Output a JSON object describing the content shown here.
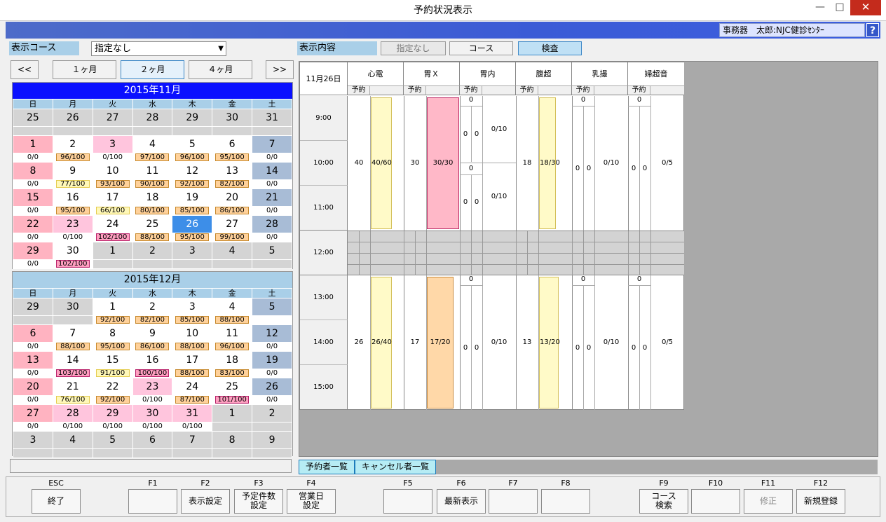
{
  "window": {
    "title": "予約状況表示",
    "minimize": "—",
    "maximize": "□",
    "close": "✕"
  },
  "header": {
    "user": "事務器　太郎:NJC健診ｾﾝﾀｰ",
    "help": "?"
  },
  "course": {
    "label": "表示コース",
    "value": "指定なし"
  },
  "display": {
    "label": "表示内容",
    "opt_none": "指定なし",
    "opt_course": "コース",
    "opt_exam": "検査"
  },
  "nav": {
    "prev": "<<",
    "m1": "１ヶ月",
    "m2": "２ヶ月",
    "m4": "４ヶ月",
    "next": ">>"
  },
  "dow": [
    "日",
    "月",
    "火",
    "水",
    "木",
    "金",
    "土"
  ],
  "calendars": [
    {
      "title": "2015年11月",
      "weeks": [
        {
          "days": [
            "25",
            "26",
            "27",
            "28",
            "29",
            "30",
            "31"
          ],
          "counts": [
            "",
            "",
            "",
            "",
            "",
            "",
            ""
          ]
        },
        {
          "days": [
            "1",
            "2",
            "3",
            "4",
            "5",
            "6",
            "7"
          ],
          "counts": [
            "0/0",
            "96/100",
            "0/100",
            "97/100",
            "96/100",
            "95/100",
            "0/0"
          ]
        },
        {
          "days": [
            "8",
            "9",
            "10",
            "11",
            "12",
            "13",
            "14"
          ],
          "counts": [
            "0/0",
            "77/100",
            "93/100",
            "90/100",
            "92/100",
            "82/100",
            "0/0"
          ]
        },
        {
          "days": [
            "15",
            "16",
            "17",
            "18",
            "19",
            "20",
            "21"
          ],
          "counts": [
            "0/0",
            "95/100",
            "66/100",
            "80/100",
            "85/100",
            "86/100",
            "0/0"
          ]
        },
        {
          "days": [
            "22",
            "23",
            "24",
            "25",
            "26",
            "27",
            "28"
          ],
          "counts": [
            "0/0",
            "0/100",
            "102/100",
            "88/100",
            "95/100",
            "99/100",
            "0/0"
          ]
        },
        {
          "days": [
            "29",
            "30",
            "1",
            "2",
            "3",
            "4",
            "5"
          ],
          "counts": [
            "0/0",
            "102/100",
            "",
            "",
            "",
            "",
            ""
          ]
        }
      ]
    },
    {
      "title": "2015年12月",
      "weeks": [
        {
          "days": [
            "29",
            "30",
            "1",
            "2",
            "3",
            "4",
            "5"
          ],
          "counts": [
            "",
            "",
            "92/100",
            "82/100",
            "85/100",
            "88/100",
            ""
          ]
        },
        {
          "days": [
            "6",
            "7",
            "8",
            "9",
            "10",
            "11",
            "12"
          ],
          "counts": [
            "0/0",
            "88/100",
            "95/100",
            "86/100",
            "88/100",
            "96/100",
            "0/0"
          ]
        },
        {
          "days": [
            "13",
            "14",
            "15",
            "16",
            "17",
            "18",
            "19"
          ],
          "counts": [
            "0/0",
            "103/100",
            "91/100",
            "100/100",
            "88/100",
            "83/100",
            "0/0"
          ]
        },
        {
          "days": [
            "20",
            "21",
            "22",
            "23",
            "24",
            "25",
            "26"
          ],
          "counts": [
            "0/0",
            "76/100",
            "92/100",
            "0/100",
            "87/100",
            "101/100",
            "0/0"
          ]
        },
        {
          "days": [
            "27",
            "28",
            "29",
            "30",
            "31",
            "1",
            "2"
          ],
          "counts": [
            "0/0",
            "0/100",
            "0/100",
            "0/100",
            "0/100",
            "",
            ""
          ]
        },
        {
          "days": [
            "3",
            "4",
            "5",
            "6",
            "7",
            "8",
            "9"
          ],
          "counts": [
            "",
            "",
            "",
            "",
            "",
            "",
            ""
          ]
        }
      ]
    }
  ],
  "schedule": {
    "date": "11月26日",
    "columns": [
      "心電",
      "胃Ｘ",
      "胃内",
      "腹超",
      "乳撮",
      "婦超音"
    ],
    "sub_label": "予約",
    "times": [
      "9:00",
      "10:00",
      "11:00",
      "12:00",
      "13:00",
      "14:00",
      "15:00"
    ],
    "am": {
      "shindenR": "40",
      "shindenBar": "40/60",
      "ixR": "30",
      "ixBar": "30/30",
      "ichinai1": "0/10",
      "ichinai2": "0/10",
      "fukuR": "18",
      "fukuBar": "18/30",
      "nyu": "0/10",
      "fujin": "0/5",
      "zero": "0"
    },
    "pm": {
      "shindenR": "26",
      "shindenBar": "26/40",
      "ixR": "17",
      "ixBar": "17/20",
      "ichinai": "0/10",
      "fukuR": "13",
      "fukuBar": "13/20",
      "nyu": "0/10",
      "fujin": "0/5",
      "zero": "0"
    }
  },
  "tabs": {
    "reserved": "予約者一覧",
    "cancelled": "キャンセル者一覧"
  },
  "fkeys": {
    "esc": {
      "key": "ESC",
      "label": "終了"
    },
    "f1": {
      "key": "F1",
      "label": ""
    },
    "f2": {
      "key": "F2",
      "label": "表示設定"
    },
    "f3": {
      "key": "F3",
      "label1": "予定件数",
      "label2": "設定"
    },
    "f4": {
      "key": "F4",
      "label1": "営業日",
      "label2": "設定"
    },
    "f5": {
      "key": "F5",
      "label": ""
    },
    "f6": {
      "key": "F6",
      "label": "最新表示"
    },
    "f7": {
      "key": "F7",
      "label": ""
    },
    "f8": {
      "key": "F8",
      "label": ""
    },
    "f9": {
      "key": "F9",
      "label1": "コース",
      "label2": "検索"
    },
    "f10": {
      "key": "F10",
      "label": ""
    },
    "f11": {
      "key": "F11",
      "label": "修正"
    },
    "f12": {
      "key": "F12",
      "label": "新規登録"
    }
  }
}
